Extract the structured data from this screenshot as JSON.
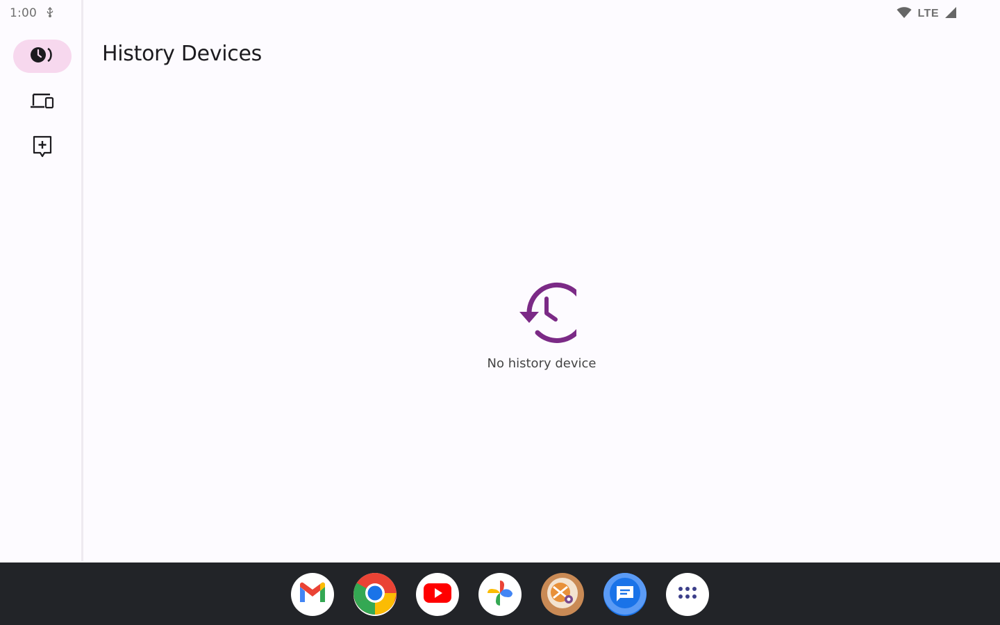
{
  "status_bar": {
    "time": "1:00",
    "network_label": "LTE",
    "icons": [
      "usb-icon",
      "wifi-icon",
      "cell-signal-icon"
    ]
  },
  "nav_rail": {
    "items": [
      {
        "name": "history",
        "icon": "history-icon",
        "active": true
      },
      {
        "name": "devices",
        "icon": "devices-icon",
        "active": false
      },
      {
        "name": "add",
        "icon": "add-box-icon",
        "active": false
      }
    ]
  },
  "main": {
    "title": "History Devices",
    "empty_state": {
      "icon": "history-icon",
      "message": "No history device",
      "accent_color": "#7b2a86"
    }
  },
  "taskbar": {
    "apps": [
      {
        "name": "gmail",
        "icon": "gmail-icon"
      },
      {
        "name": "chrome",
        "icon": "chrome-icon"
      },
      {
        "name": "youtube",
        "icon": "youtube-icon"
      },
      {
        "name": "photos",
        "icon": "photos-icon"
      },
      {
        "name": "app",
        "icon": "app-icon"
      },
      {
        "name": "messages",
        "icon": "messages-icon"
      },
      {
        "name": "app-drawer",
        "icon": "app-drawer-icon"
      }
    ]
  },
  "colors": {
    "background": "#fdfbff",
    "rail_active": "#f7d8ee",
    "accent": "#7b2a86",
    "taskbar": "#222428"
  }
}
